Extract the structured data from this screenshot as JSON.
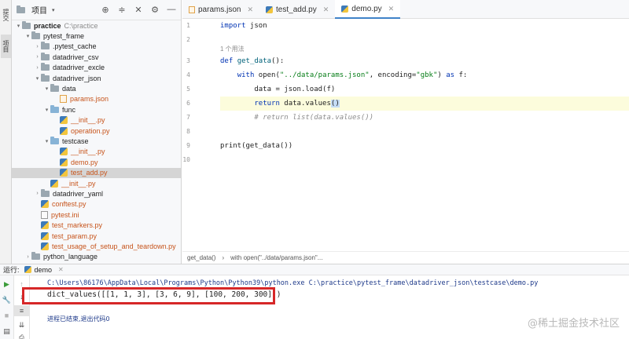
{
  "left_strip": {
    "tabs": [
      "提交",
      "项目"
    ]
  },
  "project": {
    "title": "项目",
    "dropdown": "▾",
    "tree": [
      {
        "indent": 0,
        "arrow": "▾",
        "icon": "folder",
        "name": "practice",
        "muted": "C:\\practice",
        "style": "root"
      },
      {
        "indent": 1,
        "arrow": "▾",
        "icon": "folder",
        "name": "pytest_frame"
      },
      {
        "indent": 2,
        "arrow": "›",
        "icon": "folder",
        "name": ".pytest_cache"
      },
      {
        "indent": 2,
        "arrow": "›",
        "icon": "folder",
        "name": "datadriver_csv"
      },
      {
        "indent": 2,
        "arrow": "›",
        "icon": "folder",
        "name": "datadriver_excle"
      },
      {
        "indent": 2,
        "arrow": "▾",
        "icon": "folder",
        "name": "datadriver_json"
      },
      {
        "indent": 3,
        "arrow": "▾",
        "icon": "folder",
        "name": "data"
      },
      {
        "indent": 4,
        "arrow": "",
        "icon": "json",
        "name": "params.json",
        "style": "orange"
      },
      {
        "indent": 3,
        "arrow": "▾",
        "icon": "folder-blue",
        "name": "func"
      },
      {
        "indent": 4,
        "arrow": "",
        "icon": "py",
        "name": "__init__.py",
        "style": "orange"
      },
      {
        "indent": 4,
        "arrow": "",
        "icon": "py",
        "name": "operation.py",
        "style": "orange"
      },
      {
        "indent": 3,
        "arrow": "▾",
        "icon": "folder-blue",
        "name": "testcase"
      },
      {
        "indent": 4,
        "arrow": "",
        "icon": "py",
        "name": "__init__.py",
        "style": "orange"
      },
      {
        "indent": 4,
        "arrow": "",
        "icon": "py",
        "name": "demo.py",
        "style": "orange"
      },
      {
        "indent": 4,
        "arrow": "",
        "icon": "py",
        "name": "test_add.py",
        "style": "orange",
        "selected": true
      },
      {
        "indent": 3,
        "arrow": "",
        "icon": "py",
        "name": "__init__.py",
        "style": "orange"
      },
      {
        "indent": 2,
        "arrow": "›",
        "icon": "folder",
        "name": "datadriver_yaml"
      },
      {
        "indent": 2,
        "arrow": "",
        "icon": "py",
        "name": "conftest.py",
        "style": "orange"
      },
      {
        "indent": 2,
        "arrow": "",
        "icon": "ini",
        "name": "pytest.ini",
        "style": "red"
      },
      {
        "indent": 2,
        "arrow": "",
        "icon": "py",
        "name": "test_markers.py",
        "style": "orange"
      },
      {
        "indent": 2,
        "arrow": "",
        "icon": "py",
        "name": "test_param.py",
        "style": "orange"
      },
      {
        "indent": 2,
        "arrow": "",
        "icon": "py",
        "name": "test_usage_of_setup_and_teardown.py",
        "style": "orange"
      },
      {
        "indent": 1,
        "arrow": "›",
        "icon": "folder",
        "name": "python_language"
      }
    ]
  },
  "editor": {
    "tabs": [
      {
        "label": "params.json",
        "icon": "json",
        "active": false
      },
      {
        "label": "test_add.py",
        "icon": "py",
        "active": false
      },
      {
        "label": "demo.py",
        "icon": "py",
        "active": true
      }
    ],
    "line_numbers": [
      "1",
      "2",
      "",
      "3",
      "4",
      "5",
      "6",
      "7",
      "8",
      "9",
      "10"
    ],
    "usage_hint": "1 个用法",
    "breadcrumb": [
      "get_data()",
      "with open(\"../data/params.json\"..."
    ]
  },
  "run": {
    "label": "运行:",
    "tab": "demo",
    "command": "C:\\Users\\86176\\AppData\\Local\\Programs\\Python\\Python39\\python.exe C:\\practice\\pytest_frame\\datadriver_json\\testcase\\demo.py",
    "output": "dict_values([[1, 1, 3], [3, 6, 9], [100, 200, 300]])",
    "exit": "进程已结束,退出代码0"
  },
  "watermark": "@稀土掘金技术社区"
}
